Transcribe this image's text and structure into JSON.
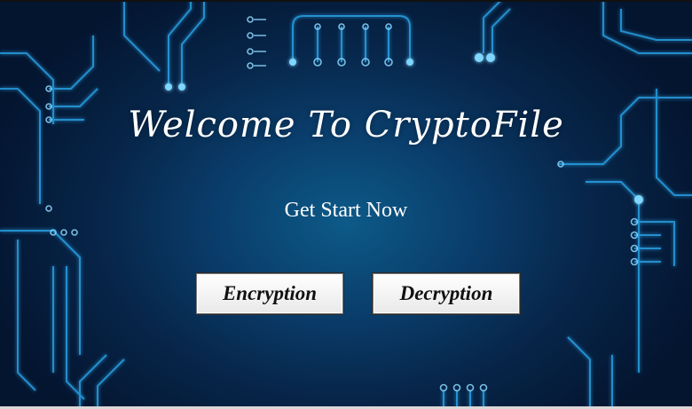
{
  "window": {
    "title": "Welcome To CryptoFile",
    "subtitle": "Get Start Now"
  },
  "buttons": {
    "encryption_label": "Encryption",
    "decryption_label": "Decryption"
  },
  "colors": {
    "background_center": "#0c5a88",
    "background_edge": "#041530",
    "circuit_glow": "#2fb6ff",
    "button_face": "#f2f2f2"
  },
  "icons": {
    "background": "circuit-board-pattern"
  }
}
